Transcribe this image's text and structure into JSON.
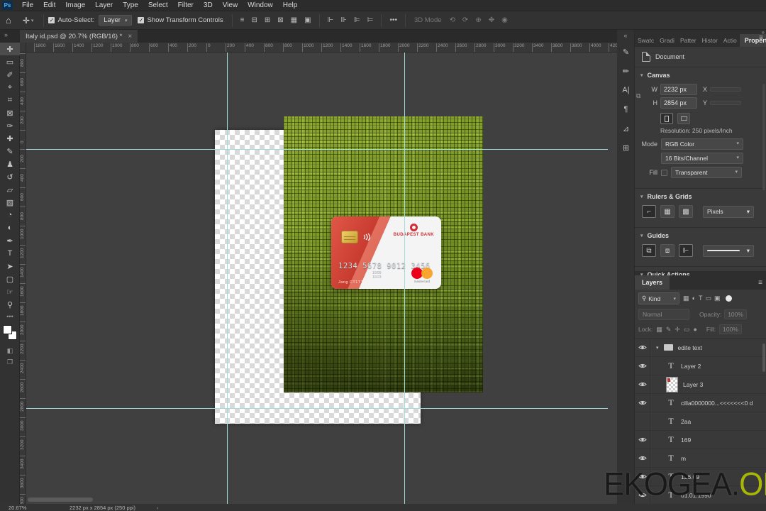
{
  "app": {
    "logo_text": "Ps"
  },
  "menu": {
    "items": [
      "File",
      "Edit",
      "Image",
      "Layer",
      "Type",
      "Select",
      "Filter",
      "3D",
      "View",
      "Window",
      "Help"
    ]
  },
  "options_bar": {
    "home_icon": "⌂",
    "move_icon": "✛",
    "auto_select_label": "Auto-Select:",
    "auto_select_value": "Layer",
    "show_transform_label": "Show Transform Controls",
    "align_icons": [
      "≡",
      "⊟",
      "⊞",
      "⊠",
      "▦",
      "▣"
    ],
    "distribute_icons": [
      "⊩",
      "⊪",
      "⊫",
      "⊨"
    ],
    "more_icon": "•••",
    "mode_3d_label": "3D Mode",
    "threed_icons": [
      "⟲",
      "⟳",
      "⊕",
      "✥",
      "◉"
    ]
  },
  "document_tab": {
    "title": "Italy id.psd @ 20.7% (RGB/16) *",
    "close": "×"
  },
  "toolbar": {
    "tools": [
      {
        "name": "move-tool",
        "glyph": "✛",
        "active": true
      },
      {
        "name": "marquee-tool",
        "glyph": "▭"
      },
      {
        "name": "lasso-tool",
        "glyph": "✐"
      },
      {
        "name": "object-selection-tool",
        "glyph": "⌖"
      },
      {
        "name": "crop-tool",
        "glyph": "⌗"
      },
      {
        "name": "frame-tool",
        "glyph": "⊠"
      },
      {
        "name": "eyedropper-tool",
        "glyph": "✑"
      },
      {
        "name": "healing-brush-tool",
        "glyph": "✚"
      },
      {
        "name": "brush-tool",
        "glyph": "✎"
      },
      {
        "name": "clone-stamp-tool",
        "glyph": "♟"
      },
      {
        "name": "history-brush-tool",
        "glyph": "↺"
      },
      {
        "name": "eraser-tool",
        "glyph": "▱"
      },
      {
        "name": "gradient-tool",
        "glyph": "▨"
      },
      {
        "name": "blur-tool",
        "glyph": "◔"
      },
      {
        "name": "dodge-tool",
        "glyph": "◐"
      },
      {
        "name": "pen-tool",
        "glyph": "✒"
      },
      {
        "name": "type-tool",
        "glyph": "T"
      },
      {
        "name": "path-select-tool",
        "glyph": "➤"
      },
      {
        "name": "shape-tool",
        "glyph": "▢"
      },
      {
        "name": "hand-tool",
        "glyph": "☞"
      },
      {
        "name": "zoom-tool",
        "glyph": "⚲"
      }
    ],
    "more_icon": "•••",
    "quick_mask_icon": "◧",
    "screen_mode_icon": "❐"
  },
  "rulers": {
    "step": 200,
    "spacing": 27,
    "h_zero": 254,
    "v_zero": 109,
    "h_from": -9,
    "h_to": 21,
    "v_from": -4,
    "v_to": 19
  },
  "canvas": {
    "guides_v": [
      283,
      533
    ],
    "guides_h": [
      136,
      501
    ]
  },
  "card": {
    "bank_name": "BUDAPEST BANK",
    "number": "1234  5678  9012  3456",
    "date_line1": "10/99",
    "date_line2": "10/23",
    "holder": "Jang CT1TT72",
    "brand": "mastercard"
  },
  "right_panels": {
    "collapse_left": "«",
    "collapse_right": "»",
    "strip_icons": [
      {
        "name": "brushes-panel-icon",
        "glyph": "✎"
      },
      {
        "name": "brush-settings-panel-icon",
        "glyph": "✏"
      },
      {
        "name": "character-panel-icon",
        "glyph": "A|"
      },
      {
        "name": "paragraph-panel-icon",
        "glyph": "¶"
      },
      {
        "name": "glyphs-panel-icon",
        "glyph": "⊿"
      },
      {
        "name": "libraries-panel-icon",
        "glyph": "⊞"
      }
    ],
    "tabs": [
      "Swatc",
      "Gradi",
      "Patter",
      "Histor",
      "Actio"
    ],
    "active_tab": "Properties",
    "menu_icon": "≡"
  },
  "properties": {
    "document_label": "Document",
    "canvas_section": "Canvas",
    "w_label": "W",
    "w_value": "2232 px",
    "x_label": "X",
    "h_label": "H",
    "h_value": "2854 px",
    "y_label": "Y",
    "resolution": "Resolution: 250 pixels/Inch",
    "mode_label": "Mode",
    "mode_value": "RGB Color",
    "depth_value": "16 Bits/Channel",
    "fill_label": "Fill",
    "fill_value": "Transparent",
    "rulers_section": "Rulers & Grids",
    "units_value": "Pixels",
    "guides_section": "Guides",
    "quick_actions_section": "Quick Actions"
  },
  "layers_panel": {
    "tab": "Layers",
    "menu_icon": "≡",
    "kind_label": "Kind",
    "filter_icons": [
      "▦",
      "◐",
      "T",
      "▭",
      "▣"
    ],
    "blend_mode": "Normal",
    "opacity_label": "Opacity:",
    "opacity_value": "100%",
    "lock_label": "Lock:",
    "lock_icons": [
      "▦",
      "✎",
      "✛",
      "▭",
      "●"
    ],
    "fill_label": "Fill:",
    "fill_value": "100%",
    "layers": [
      {
        "name": "edite text",
        "type": "group",
        "visible": true
      },
      {
        "name": "Layer 2",
        "type": "text",
        "visible": true
      },
      {
        "name": "Layer 3",
        "type": "image",
        "visible": true
      },
      {
        "name": "cilla0000000...<<<<<<<0 d",
        "type": "text",
        "visible": true
      },
      {
        "name": "2aa",
        "type": "text",
        "visible": false
      },
      {
        "name": "169",
        "type": "text",
        "visible": true
      },
      {
        "name": "m",
        "type": "text",
        "visible": true
      },
      {
        "name": "126.09",
        "type": "text",
        "visible": true
      },
      {
        "name": "01.01.1990",
        "type": "text",
        "visible": true
      }
    ],
    "footer_icons": [
      "∞",
      "fx",
      "▣",
      "◐",
      "▤",
      "⊞",
      "⌦"
    ]
  },
  "status_bar": {
    "zoom": "20.67%",
    "doc_info": "2232 px x 2854 px (250 ppi)",
    "chevron": "›"
  },
  "watermark": {
    "dark": "EKOGEA.",
    "accent": "ORG",
    "accent_color": "#a6b705"
  }
}
